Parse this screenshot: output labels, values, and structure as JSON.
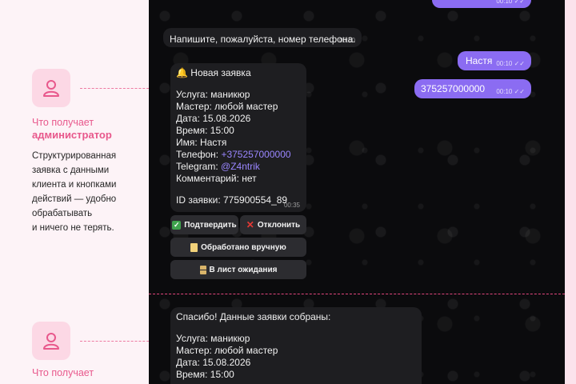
{
  "messages": {
    "prompt_phone": {
      "text": "Напишите, пожалуйста, номер телефона.",
      "time": "00:10"
    },
    "reply_name": {
      "text": "Настя",
      "time": "00:10"
    },
    "reply_phone": {
      "text": "375257000000",
      "time": "00:10"
    },
    "new_request": {
      "header": "Новая заявка",
      "header_icon": "bell-icon",
      "service": "Услуга: маникюр",
      "master": "Мастер: любой мастер",
      "date": "Дата: 15.08.2026",
      "time_line": "Время: 15:00",
      "name": "Имя: Настя",
      "phone_label": "Телефон: ",
      "phone_link": "+375257000000",
      "telegram_label": "Telegram: ",
      "telegram_link": "@Z4ntrik",
      "comment": "Комментарий: нет",
      "request_id": "ID заявки: 775900554_89",
      "time": "00:35"
    },
    "thanks": {
      "header": "Спасибо! Данные заявки собраны:",
      "service": "Услуга: маникюр",
      "master": "Мастер: любой мастер",
      "date": "Дата: 15.08.2026",
      "time_line": "Время: 15:00"
    }
  },
  "keyboard": {
    "confirm": "Подтвердить",
    "reject": "Отклонить",
    "manual": "Обработано вручную",
    "waitlist": "В лист ожидания"
  },
  "sections": [
    {
      "title_line1": "Что получает",
      "title_line2": "администратор",
      "desc": [
        "Структурированная",
        "заявка с данными",
        "клиента и кнопками",
        "действий — удобно",
        "обрабатывать",
        "и ничего не терять."
      ],
      "icon": "user-icon"
    },
    {
      "title_line1": "Что получает",
      "icon": "user-icon"
    }
  ],
  "colors": {
    "accent_pink": "#e8588c",
    "outgoing_bubble": "#8b6cf2",
    "incoming_bubble": "#1e1e21",
    "link": "#9a86ff",
    "chat_bg": "#0b0b0d"
  }
}
